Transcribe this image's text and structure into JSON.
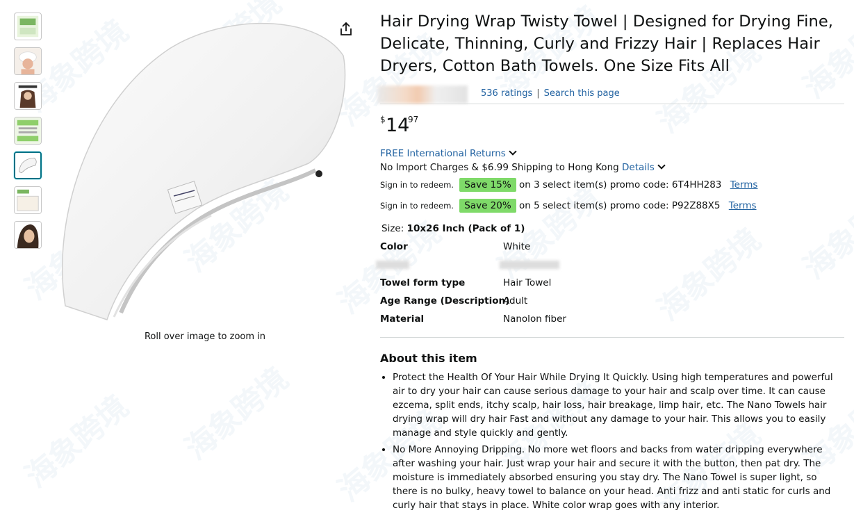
{
  "product": {
    "title": "Hair Drying Wrap Twisty Towel | Designed for Drying Fine, Delicate, Thinning, Curly and Frizzy Hair | Replaces Hair Dryers, Cotton Bath Towels. One Size Fits All",
    "ratings_count": "536 ratings",
    "search_link": "Search this page",
    "price": {
      "symbol": "$",
      "whole": "14",
      "fraction": "97"
    },
    "returns": "FREE International Returns",
    "shipping": "No Import Charges & $6.99 Shipping to Hong Kong",
    "shipping_details": "Details",
    "promos": [
      {
        "sign": "Sign in to redeem.",
        "badge": "Save 15%",
        "text": "on 3 select item(s) promo code: 6T4HH283",
        "terms": "Terms"
      },
      {
        "sign": "Sign in to redeem.",
        "badge": "Save 20%",
        "text": "on 5 select item(s) promo code: P92Z88X5",
        "terms": "Terms"
      }
    ],
    "size_label": "Size:",
    "size_value": "10x26 Inch (Pack of 1)",
    "specs": [
      {
        "key": "Color",
        "value": "White"
      },
      {
        "key": "Towel form type",
        "value": "Hair Towel"
      },
      {
        "key": "Age Range (Description)",
        "value": "Adult"
      },
      {
        "key": "Material",
        "value": "Nanolon fiber"
      }
    ],
    "about_title": "About this item",
    "bullets": [
      "Protect the Health Of Your Hair While Drying It Quickly. Using high temperatures and powerful air to dry your hair can cause serious damage to your hair and scalp over time. It can cause ezcema, split ends, itchy scalp, hair loss, hair breakage, limp hair, etc. The Nano Towels hair drying wrap will dry hair Fast and without any damage to your hair. This allows you to easily manage and style quickly and gently.",
      "No More Annoying Dripping. No more wet floors and backs from water dripping everywhere after washing your hair. Just wrap your hair and secure it with the button, then pat dry. The moisture is immediately absorbed ensuring you stay dry. The Nano Towel is super light, so there is no bulky, heavy towel to balance on your head. Anti frizz and anti static for curls and curly hair that stays in place. White color wrap goes with any interior."
    ]
  },
  "gallery": {
    "zoom_hint": "Roll over image to zoom in",
    "thumbnail_count": 7,
    "active_index": 4
  },
  "watermark_text": "海象跨境"
}
